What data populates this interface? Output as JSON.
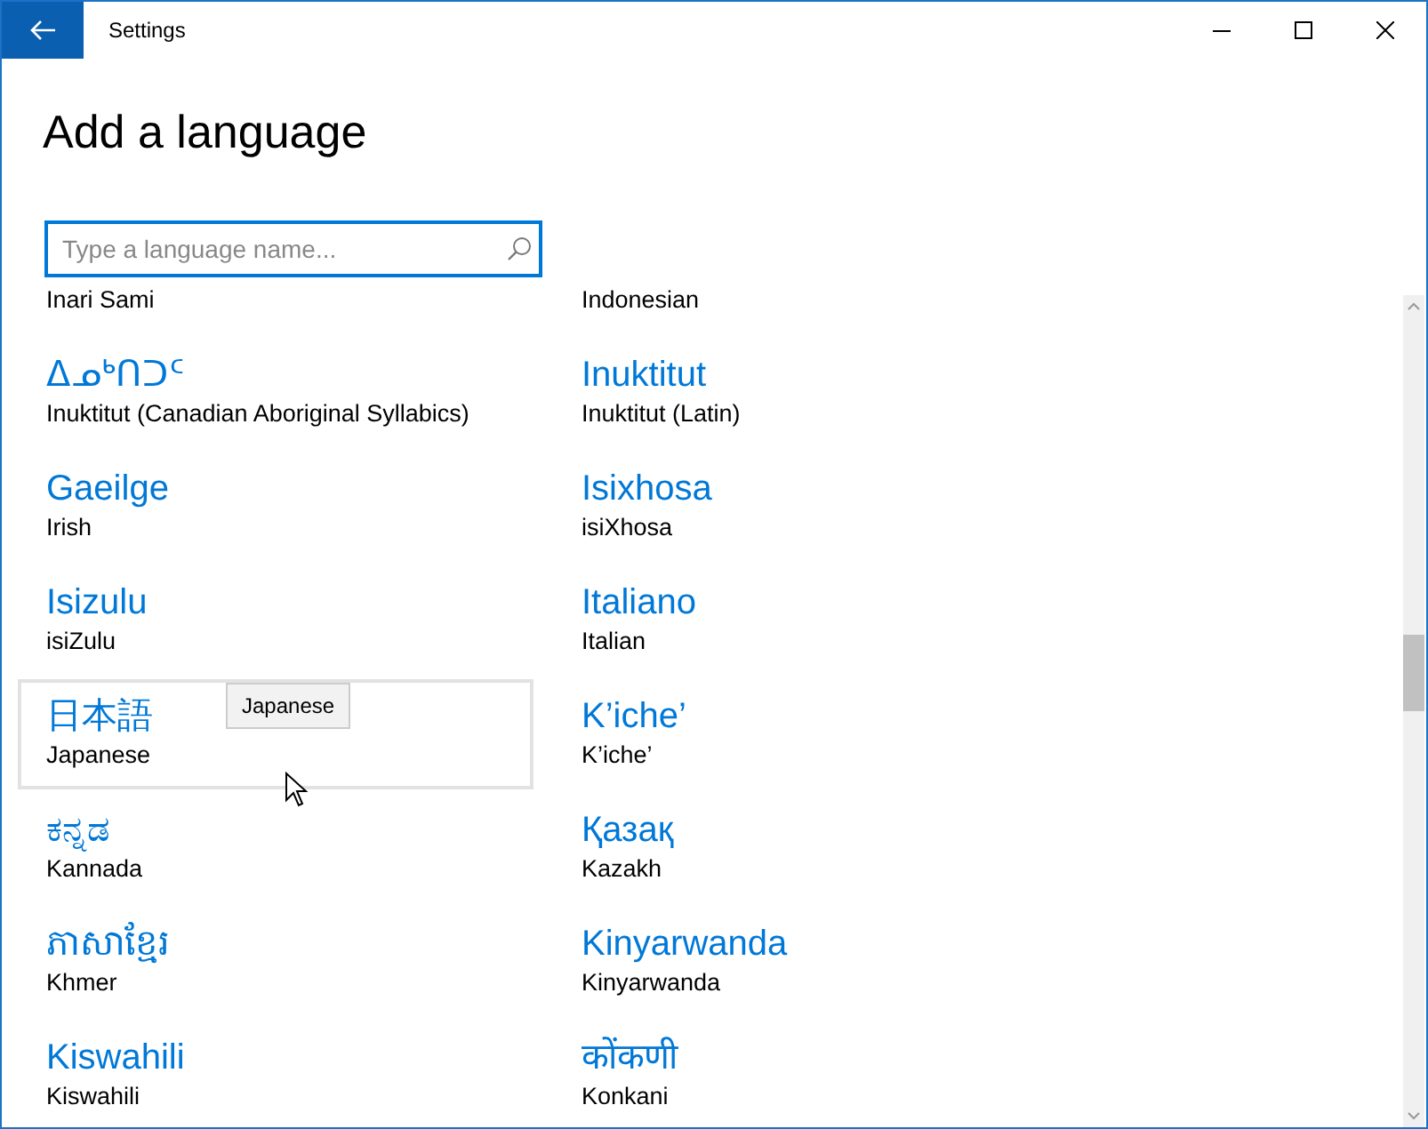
{
  "window": {
    "title": "Settings"
  },
  "page": {
    "heading": "Add a language"
  },
  "search": {
    "placeholder": "Type a language name..."
  },
  "languages": [
    {
      "subtitle": "Inari Sami",
      "hovered": false
    },
    {
      "subtitle": "Indonesian",
      "hovered": false
    },
    {
      "title": "ᐃᓄᒃᑎᑐᑦ",
      "subtitle": "Inuktitut (Canadian Aboriginal Syllabics)",
      "hovered": false
    },
    {
      "title": "Inuktitut",
      "subtitle": "Inuktitut (Latin)",
      "hovered": false
    },
    {
      "title": "Gaeilge",
      "subtitle": "Irish",
      "hovered": false
    },
    {
      "title": "Isixhosa",
      "subtitle": "isiXhosa",
      "hovered": false
    },
    {
      "title": "Isizulu",
      "subtitle": "isiZulu",
      "hovered": false
    },
    {
      "title": "Italiano",
      "subtitle": "Italian",
      "hovered": false
    },
    {
      "title": "日本語",
      "subtitle": "Japanese",
      "hovered": true,
      "tooltip": "Japanese"
    },
    {
      "title": "K’iche’",
      "subtitle": "K’iche’",
      "hovered": false
    },
    {
      "title": "ಕನ್ನಡ",
      "subtitle": "Kannada",
      "hovered": false
    },
    {
      "title": "Қазақ",
      "subtitle": "Kazakh",
      "hovered": false
    },
    {
      "title": "ភាសាខ្មែរ",
      "subtitle": "Khmer",
      "hovered": false
    },
    {
      "title": "Kinyarwanda",
      "subtitle": "Kinyarwanda",
      "hovered": false
    },
    {
      "title": "Kiswahili",
      "subtitle": "Kiswahili",
      "hovered": false
    },
    {
      "title": "कोंकणी",
      "subtitle": "Konkani",
      "hovered": false
    }
  ]
}
